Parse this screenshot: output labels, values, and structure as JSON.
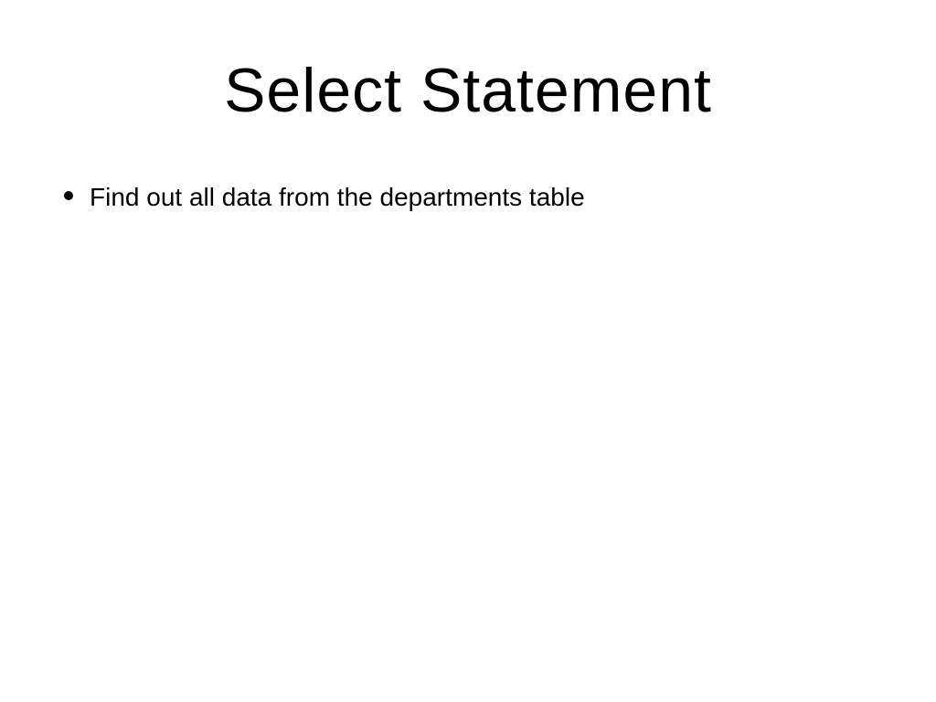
{
  "slide": {
    "title": "Select Statement",
    "bullets": [
      {
        "text": "Find out all data from the departments table"
      }
    ]
  }
}
